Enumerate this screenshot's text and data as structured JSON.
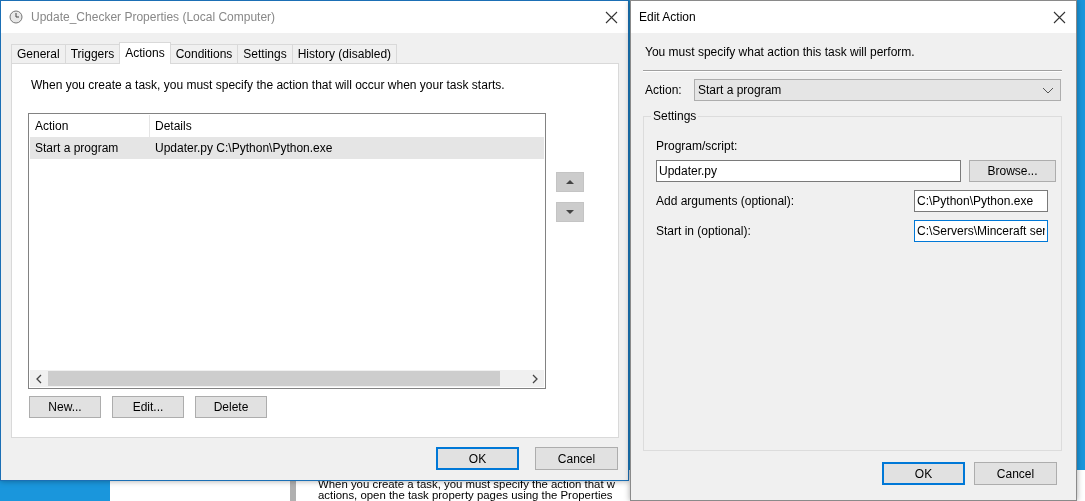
{
  "background_window": {
    "lines": [
      "When you create a task, you must specify the action that w",
      "actions, open the task property pages using the Properties"
    ]
  },
  "properties_window": {
    "title": "Update_Checker Properties (Local Computer)",
    "active": false,
    "tabs": [
      {
        "label": "General",
        "selected": false
      },
      {
        "label": "Triggers",
        "selected": false
      },
      {
        "label": "Actions",
        "selected": true
      },
      {
        "label": "Conditions",
        "selected": false
      },
      {
        "label": "Settings",
        "selected": false
      },
      {
        "label": "History (disabled)",
        "selected": false
      }
    ],
    "description": "When you create a task, you must specify the action that will occur when your task starts.",
    "actions_table": {
      "columns": [
        "Action",
        "Details"
      ],
      "rows": [
        {
          "action": "Start a program",
          "details": "Updater.py C:\\Python\\Python.exe",
          "selected": true
        }
      ]
    },
    "list_buttons": [
      "New...",
      "Edit...",
      "Delete"
    ],
    "dialog_buttons": [
      {
        "label": "OK",
        "default": true
      },
      {
        "label": "Cancel",
        "default": false
      }
    ]
  },
  "edit_action_dialog": {
    "title": "Edit Action",
    "active": true,
    "description": "You must specify what action this task will perform.",
    "action_label": "Action:",
    "action_value": "Start a program",
    "group_label": "Settings",
    "program": {
      "label": "Program/script:",
      "value": "Updater.py",
      "focused": false
    },
    "browse_button": "Browse...",
    "fields": [
      {
        "label": "Add arguments (optional):",
        "value": "C:\\Python\\Python.exe",
        "focused": false
      },
      {
        "label": "Start in (optional):",
        "value": "C:\\Servers\\Minceraft ser",
        "focused": true
      }
    ],
    "dialog_buttons": [
      {
        "label": "OK",
        "default": true
      },
      {
        "label": "Cancel",
        "default": false
      }
    ]
  }
}
